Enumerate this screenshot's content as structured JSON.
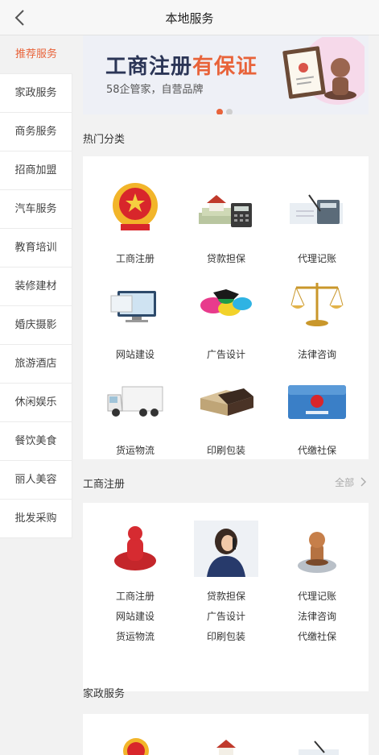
{
  "header": {
    "title": "本地服务",
    "back_icon": "chevron-left-icon"
  },
  "sidebar": {
    "items": [
      {
        "label": "推荐服务",
        "active": true
      },
      {
        "label": "家政服务"
      },
      {
        "label": "商务服务"
      },
      {
        "label": "招商加盟"
      },
      {
        "label": "汽车服务"
      },
      {
        "label": "教育培训"
      },
      {
        "label": "装修建材"
      },
      {
        "label": "婚庆摄影"
      },
      {
        "label": "旅游酒店"
      },
      {
        "label": "休闲娱乐"
      },
      {
        "label": "餐饮美食"
      },
      {
        "label": "丽人美容"
      },
      {
        "label": "批发采购"
      }
    ]
  },
  "banner": {
    "title_main": "工商注册",
    "title_accent": "有保证",
    "subtitle": "58企管家，自营品牌",
    "dots": 2,
    "active_dot": 0
  },
  "hot": {
    "title": "热门分类",
    "items": [
      {
        "label": "工商注册",
        "icon": "national-emblem-icon"
      },
      {
        "label": "贷款担保",
        "icon": "house-money-calculator-icon"
      },
      {
        "label": "代理记账",
        "icon": "accounting-calculator-icon"
      },
      {
        "label": "网站建设",
        "icon": "computer-screens-icon"
      },
      {
        "label": "广告设计",
        "icon": "paint-splash-horse-icon"
      },
      {
        "label": "法律咨询",
        "icon": "scales-of-justice-icon"
      },
      {
        "label": "货运物流",
        "icon": "delivery-truck-icon"
      },
      {
        "label": "印刷包装",
        "icon": "packaging-box-icon"
      },
      {
        "label": "代缴社保",
        "icon": "social-security-card-icon"
      }
    ]
  },
  "business": {
    "title": "工商注册",
    "more": "全部",
    "images": [
      "red-stamp-icon",
      "businesswoman-phone-icon",
      "wooden-stamp-icon"
    ],
    "links": [
      "工商注册",
      "贷款担保",
      "代理记账",
      "网站建设",
      "广告设计",
      "法律咨询",
      "货运物流",
      "印刷包装",
      "代缴社保"
    ]
  },
  "home": {
    "title": "家政服务"
  },
  "colors": {
    "accent": "#e8633a",
    "background": "#f2f2f2"
  }
}
